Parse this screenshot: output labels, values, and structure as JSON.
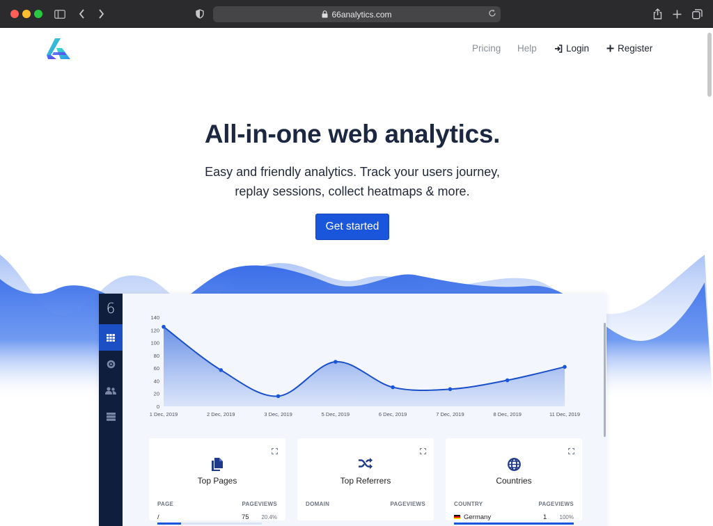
{
  "browser": {
    "url": "66analytics.com"
  },
  "nav": {
    "pricing": "Pricing",
    "help": "Help",
    "login": "Login",
    "register": "Register"
  },
  "hero": {
    "title": "All-in-one web analytics.",
    "subtitle_line1": "Easy and friendly analytics. Track your users journey,",
    "subtitle_line2": "replay sessions, collect heatmaps & more.",
    "cta": "Get started"
  },
  "dashboard": {
    "logo": "6",
    "sidebar_icons": [
      "grid-icon",
      "target-icon",
      "users-icon",
      "server-icon"
    ],
    "cards": [
      {
        "title": "Top Pages",
        "icon": "pages-icon",
        "col1": "PAGE",
        "col2": "PAGEVIEWS",
        "row": {
          "label": "/",
          "value": "75",
          "pct": "20.4%"
        }
      },
      {
        "title": "Top Referrers",
        "icon": "shuffle-icon",
        "col1": "DOMAIN",
        "col2": "PAGEVIEWS"
      },
      {
        "title": "Countries",
        "icon": "globe-icon",
        "col1": "COUNTRY",
        "col2": "PAGEVIEWS",
        "row": {
          "label": "Germany",
          "value": "1",
          "pct": "100%"
        }
      }
    ]
  },
  "colors": {
    "accent": "#1a56db",
    "sidebar": "#0f1e3d",
    "title": "#1c2740"
  },
  "chart_data": {
    "type": "area",
    "categories": [
      "1 Dec, 2019",
      "2 Dec, 2019",
      "3 Dec, 2019",
      "5 Dec, 2019",
      "6 Dec, 2019",
      "7 Dec, 2019",
      "8 Dec, 2019",
      "11 Dec, 2019"
    ],
    "values": [
      125,
      57,
      16,
      70,
      30,
      27,
      41,
      62
    ],
    "yticks": [
      0,
      20,
      40,
      60,
      80,
      100,
      120,
      140
    ],
    "ylim": [
      0,
      140
    ],
    "color": "#1a56db"
  }
}
